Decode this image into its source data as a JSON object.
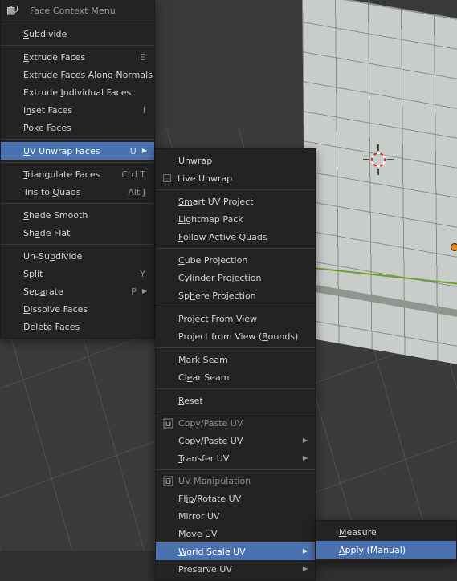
{
  "viewport": {
    "name": "blender-3d-viewport",
    "colors": {
      "background": "#3b3b3b",
      "sky": "#393939",
      "object": "#c9cdc9",
      "y_axis": "#6f9f34",
      "origin": "#e8881a"
    }
  },
  "theme": {
    "menu_bg": "#232323",
    "highlight": "#4b72b0",
    "text": "#d2d2d2",
    "text_dim": "#8b8b8b",
    "separator": "#3a3a3a"
  },
  "face_menu": {
    "header": {
      "icon": "face-select-icon",
      "title": "Face Context Menu"
    },
    "groups": [
      {
        "items": [
          {
            "label": "Subdivide",
            "acc": "S",
            "shortcut": "",
            "submenu": false,
            "selected": false
          }
        ]
      },
      {
        "items": [
          {
            "label": "Extrude Faces",
            "acc": "E",
            "shortcut": "E",
            "submenu": false,
            "selected": false
          },
          {
            "label": "Extrude Faces Along Normals",
            "acc": "F",
            "shortcut": "",
            "submenu": false,
            "selected": false
          },
          {
            "label": "Extrude Individual Faces",
            "acc": "I",
            "shortcut": "",
            "submenu": false,
            "selected": false
          },
          {
            "label": "Inset Faces",
            "acc": "n",
            "shortcut": "I",
            "submenu": false,
            "selected": false
          },
          {
            "label": "Poke Faces",
            "acc": "P",
            "shortcut": "",
            "submenu": false,
            "selected": false
          }
        ]
      },
      {
        "items": [
          {
            "label": "UV Unwrap Faces",
            "acc": "U",
            "shortcut": "U",
            "submenu": true,
            "selected": true
          }
        ]
      },
      {
        "items": [
          {
            "label": "Triangulate Faces",
            "acc": "T",
            "shortcut": "Ctrl T",
            "submenu": false,
            "selected": false
          },
          {
            "label": "Tris to Quads",
            "acc": "Q",
            "shortcut": "Alt J",
            "submenu": false,
            "selected": false
          }
        ]
      },
      {
        "items": [
          {
            "label": "Shade Smooth",
            "acc": "S",
            "shortcut": "",
            "submenu": false,
            "selected": false
          },
          {
            "label": "Shade Flat",
            "acc": "a",
            "shortcut": "",
            "submenu": false,
            "selected": false
          }
        ]
      },
      {
        "items": [
          {
            "label": "Un-Subdivide",
            "acc": "b",
            "shortcut": "",
            "submenu": false,
            "selected": false
          },
          {
            "label": "Split",
            "acc": "l",
            "shortcut": "Y",
            "submenu": false,
            "selected": false
          },
          {
            "label": "Separate",
            "acc": "a",
            "shortcut": "P",
            "submenu": true,
            "selected": false
          },
          {
            "label": "Dissolve Faces",
            "acc": "D",
            "shortcut": "",
            "submenu": false,
            "selected": false
          },
          {
            "label": "Delete Faces",
            "acc": "c",
            "shortcut": "",
            "submenu": false,
            "selected": false
          }
        ]
      }
    ]
  },
  "uv_menu": {
    "groups": [
      {
        "items": [
          {
            "label": "Unwrap",
            "acc": "U",
            "checkbox": false,
            "section": false,
            "submenu": false,
            "selected": false
          },
          {
            "label": "Live Unwrap",
            "acc": "",
            "checkbox": true,
            "checked": false,
            "section": false,
            "submenu": false,
            "selected": false
          }
        ]
      },
      {
        "items": [
          {
            "label": "Smart UV Project",
            "acc": "Sm",
            "checkbox": false,
            "section": false,
            "submenu": false,
            "selected": false
          },
          {
            "label": "Lightmap Pack",
            "acc": "Li",
            "checkbox": false,
            "section": false,
            "submenu": false,
            "selected": false
          },
          {
            "label": "Follow Active Quads",
            "acc": "F",
            "checkbox": false,
            "section": false,
            "submenu": false,
            "selected": false
          }
        ]
      },
      {
        "items": [
          {
            "label": "Cube Projection",
            "acc": "C",
            "checkbox": false,
            "section": false,
            "submenu": false,
            "selected": false
          },
          {
            "label": "Cylinder Projection",
            "acc": "P",
            "checkbox": false,
            "section": false,
            "submenu": false,
            "selected": false
          },
          {
            "label": "Sphere Projection",
            "acc": "h",
            "checkbox": false,
            "section": false,
            "submenu": false,
            "selected": false
          }
        ]
      },
      {
        "items": [
          {
            "label": "Project From View",
            "acc": "V",
            "checkbox": false,
            "section": false,
            "submenu": false,
            "selected": false
          },
          {
            "label": "Project from View (Bounds)",
            "acc": "B",
            "checkbox": false,
            "section": false,
            "submenu": false,
            "selected": false
          }
        ]
      },
      {
        "items": [
          {
            "label": "Mark Seam",
            "acc": "M",
            "checkbox": false,
            "section": false,
            "submenu": false,
            "selected": false
          },
          {
            "label": "Clear Seam",
            "acc": "e",
            "checkbox": false,
            "section": false,
            "submenu": false,
            "selected": false
          }
        ]
      },
      {
        "items": [
          {
            "label": "Reset",
            "acc": "R",
            "checkbox": false,
            "section": false,
            "submenu": false,
            "selected": false
          }
        ]
      },
      {
        "items": [
          {
            "label": "Copy/Paste UV",
            "acc": "",
            "icon": "script-icon",
            "section": true,
            "submenu": false,
            "selected": false
          },
          {
            "label": "Copy/Paste UV",
            "acc": "o",
            "checkbox": false,
            "section": false,
            "submenu": true,
            "selected": false
          },
          {
            "label": "Transfer UV",
            "acc": "T",
            "checkbox": false,
            "section": false,
            "submenu": true,
            "selected": false
          }
        ]
      },
      {
        "items": [
          {
            "label": "UV Manipulation",
            "acc": "",
            "icon": "script-icon",
            "section": true,
            "submenu": false,
            "selected": false
          },
          {
            "label": "Flip/Rotate UV",
            "acc": "ip",
            "checkbox": false,
            "section": false,
            "submenu": false,
            "selected": false
          },
          {
            "label": "Mirror UV",
            "acc": "",
            "checkbox": false,
            "section": false,
            "submenu": false,
            "selected": false
          },
          {
            "label": "Move UV",
            "acc": "",
            "checkbox": false,
            "section": false,
            "submenu": false,
            "selected": false
          },
          {
            "label": "World Scale UV",
            "acc": "W",
            "checkbox": false,
            "section": false,
            "submenu": true,
            "selected": true
          },
          {
            "label": "Preserve UV",
            "acc": "",
            "checkbox": false,
            "section": false,
            "submenu": true,
            "selected": false
          }
        ]
      }
    ]
  },
  "world_scale_menu": {
    "items": [
      {
        "label": "Measure",
        "acc": "M",
        "selected": false
      },
      {
        "label": "Apply (Manual)",
        "acc": "A",
        "selected": true
      }
    ]
  }
}
